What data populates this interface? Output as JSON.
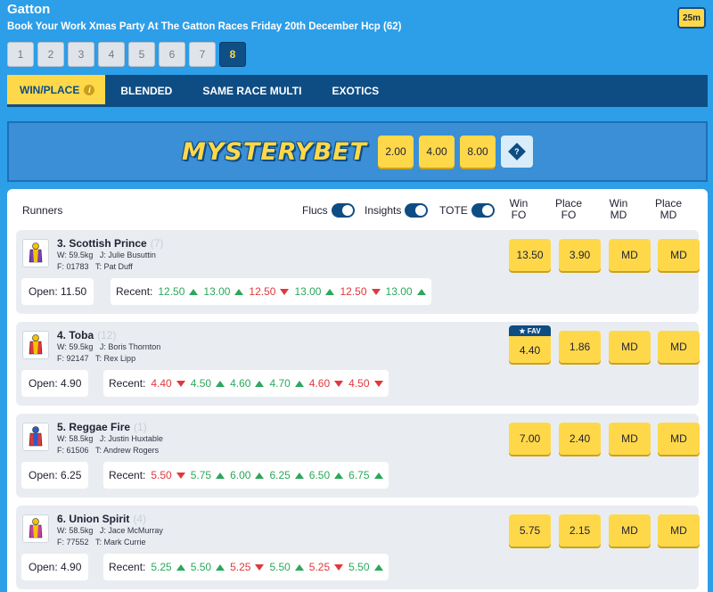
{
  "header": {
    "venue": "Gatton",
    "race_name": "Book Your Work Xmas Party At The Gatton Races Friday 20th December Hcp (62)",
    "timer": "25m"
  },
  "race_tabs": [
    "1",
    "2",
    "3",
    "4",
    "5",
    "6",
    "7",
    "8"
  ],
  "active_race": "8",
  "bet_nav": {
    "win_place": "WIN/PLACE",
    "info": "i",
    "blended": "BLENDED",
    "same_race_multi": "SAME RACE MULTI",
    "exotics": "EXOTICS"
  },
  "mysterybet": {
    "logo": "MYSTERYBET",
    "amounts": [
      "2.00",
      "4.00",
      "8.00"
    ],
    "help": "?"
  },
  "table": {
    "runners_label": "Runners",
    "toggles": {
      "flucs": "Flucs",
      "insights": "Insights",
      "tote": "TOTE"
    },
    "columns": {
      "win_fo": [
        "Win",
        "FO"
      ],
      "place_fo": [
        "Place",
        "FO"
      ],
      "win_md": [
        "Win",
        "MD"
      ],
      "place_md": [
        "Place",
        "MD"
      ]
    },
    "open_label": "Open:",
    "recent_label": "Recent:"
  },
  "runners": [
    {
      "name": "3. Scottish Prince",
      "ghost": "(7)",
      "weight": "W: 59.5kg",
      "jockey": "J: Julie Busuttin",
      "form": "F: 01783",
      "trainer": "T: Pat Duff",
      "open": "11.50",
      "recent": [
        [
          "12.50",
          "up"
        ],
        [
          "13.00",
          "up"
        ],
        [
          "12.50",
          "down"
        ],
        [
          "13.00",
          "up"
        ],
        [
          "12.50",
          "down"
        ],
        [
          "13.00",
          "up"
        ]
      ],
      "win_fo": "13.50",
      "place_fo": "3.90",
      "win_md": "MD",
      "place_md": "MD",
      "fav": false
    },
    {
      "name": "4. Toba",
      "ghost": "(12)",
      "weight": "W: 59.5kg",
      "jockey": "J: Boris Thornton",
      "form": "F: 92147",
      "trainer": "T: Rex Lipp",
      "open": "4.90",
      "recent": [
        [
          "4.40",
          "down"
        ],
        [
          "4.50",
          "up"
        ],
        [
          "4.60",
          "up"
        ],
        [
          "4.70",
          "up"
        ],
        [
          "4.60",
          "down"
        ],
        [
          "4.50",
          "down"
        ]
      ],
      "win_fo": "4.40",
      "place_fo": "1.86",
      "win_md": "MD",
      "place_md": "MD",
      "fav": true,
      "fav_label": "★ FAV"
    },
    {
      "name": "5. Reggae Fire",
      "ghost": "(1)",
      "weight": "W: 58.5kg",
      "jockey": "J: Justin Huxtable",
      "form": "F: 61506",
      "trainer": "T: Andrew Rogers",
      "open": "6.25",
      "recent": [
        [
          "5.50",
          "down"
        ],
        [
          "5.75",
          "up"
        ],
        [
          "6.00",
          "up"
        ],
        [
          "6.25",
          "up"
        ],
        [
          "6.50",
          "up"
        ],
        [
          "6.75",
          "up"
        ]
      ],
      "win_fo": "7.00",
      "place_fo": "2.40",
      "win_md": "MD",
      "place_md": "MD",
      "fav": false
    },
    {
      "name": "6. Union Spirit",
      "ghost": "(4)",
      "weight": "W: 58.5kg",
      "jockey": "J: Jace McMurray",
      "form": "F: 77552",
      "trainer": "T: Mark Currie",
      "open": "4.90",
      "recent": [
        [
          "5.25",
          "up"
        ],
        [
          "5.50",
          "up"
        ],
        [
          "5.25",
          "down"
        ],
        [
          "5.50",
          "up"
        ],
        [
          "5.25",
          "down"
        ],
        [
          "5.50",
          "up"
        ]
      ],
      "win_fo": "5.75",
      "place_fo": "2.15",
      "win_md": "MD",
      "place_md": "MD",
      "fav": false
    }
  ],
  "colors": {
    "background": "#2d9ee8",
    "navy": "#0e4d84",
    "yellow": "#ffd84a",
    "up": "#2aa85b",
    "down": "#e0383e"
  }
}
